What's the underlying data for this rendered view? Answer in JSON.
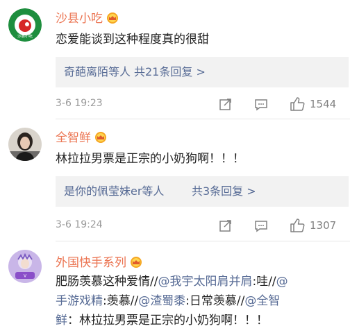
{
  "comments": [
    {
      "username": "沙县小吃",
      "avatar_text": "沙县小吃",
      "text": "恋爱能谈到这种程度真的很甜",
      "reply_who": "奇葩离陌等人",
      "reply_count": "共21条回复 >",
      "timestamp": "3-6 19:23",
      "likes": "1544"
    },
    {
      "username": "全智鲜",
      "text": "林拉拉男票是正宗的小奶狗啊！！！",
      "reply_who": "是你的佩莹妹er等人",
      "reply_count": "共3条回复 >",
      "timestamp": "3-6 19:24",
      "likes": "1307"
    },
    {
      "username": "外国快手系列",
      "text_parts": [
        "肥肠羡慕这种爱情//",
        "@我宇太阳肩并肩",
        ":哇//",
        "@",
        "手游戏精",
        ":羡慕//",
        "@渣蜀黍",
        ":日常羡慕//",
        "@全智",
        "鲜",
        "：林拉拉男票是正宗的小奶狗啊！！！"
      ]
    }
  ],
  "colors": {
    "username": "#eb7350",
    "link": "#576b95",
    "meta": "#999999",
    "reply_bg": "#f2f2f2"
  },
  "icons": [
    "crown-badge-icon",
    "share-icon",
    "comment-icon",
    "like-icon"
  ]
}
